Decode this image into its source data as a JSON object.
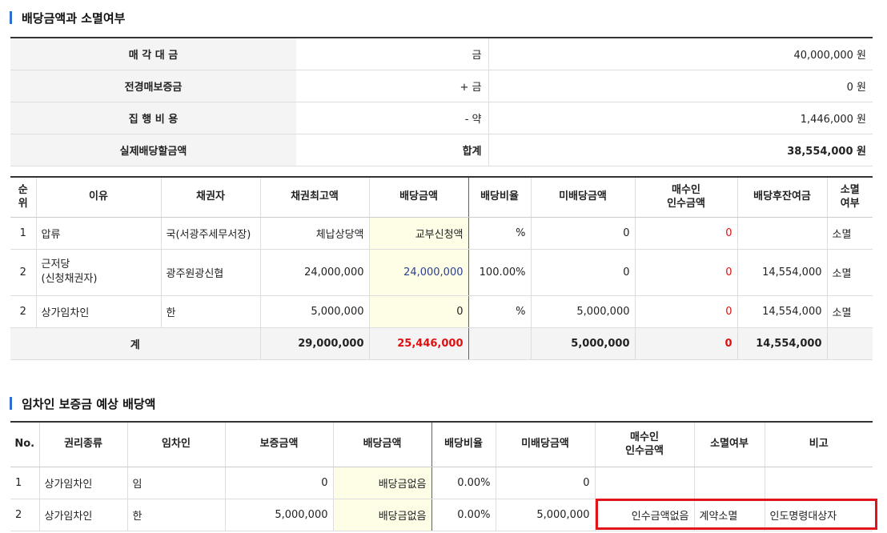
{
  "section1": {
    "title": "배당금액과 소멸여부"
  },
  "summary": [
    {
      "label": "매 각 대 금",
      "sign": "금",
      "amount": "40,000,000 원"
    },
    {
      "label": "전경매보증금",
      "sign": "+ 금",
      "amount": "0 원"
    },
    {
      "label": "집 행 비 용",
      "sign": "- 약",
      "amount": "1,446,000 원"
    },
    {
      "label": "실제배당할금액",
      "sign": "합계",
      "amount": "38,554,000 원"
    }
  ],
  "distribution": {
    "headers": [
      "순\n위",
      "이유",
      "채권자",
      "채권최고액",
      "배당금액",
      "배당비율",
      "미배당금액",
      "매수인\n인수금액",
      "배당후잔여금",
      "소멸\n여부"
    ],
    "rows": [
      {
        "rank": "1",
        "reason": "압류",
        "creditor": "국(서광주세무서장)",
        "max": "체납상당액",
        "paid": "교부신청액",
        "ratio": "%",
        "unpaid": "0",
        "buyer": "0",
        "remain": "",
        "status": "소멸"
      },
      {
        "rank": "2",
        "reason": "근저당\n(신청채권자)",
        "creditor": "광주원광신협",
        "max": "24,000,000",
        "paid": "24,000,000",
        "ratio": "100.00%",
        "unpaid": "0",
        "buyer": "0",
        "remain": "14,554,000",
        "status": "소멸"
      },
      {
        "rank": "2",
        "reason": "상가임차인",
        "creditor": "한",
        "max": "5,000,000",
        "paid": "0",
        "ratio": "%",
        "unpaid": "5,000,000",
        "buyer": "0",
        "remain": "14,554,000",
        "status": "소멸"
      }
    ],
    "total": {
      "label": "계",
      "max": "29,000,000",
      "paid": "25,446,000",
      "unpaid": "5,000,000",
      "buyer": "0",
      "remain": "14,554,000"
    }
  },
  "section2": {
    "title": "임차인 보증금 예상 배당액"
  },
  "tenant": {
    "headers": [
      "No.",
      "권리종류",
      "임차인",
      "보증금액",
      "배당금액",
      "배당비율",
      "미배당금액",
      "매수인\n인수금액",
      "소멸여부",
      "비고"
    ],
    "rows": [
      {
        "no": "1",
        "type": "상가임차인",
        "tenant": "임",
        "deposit": "0",
        "paid": "배당금없음",
        "ratio": "0.00%",
        "unpaid": "0",
        "buyer": "",
        "status": "",
        "note": ""
      },
      {
        "no": "2",
        "type": "상가임차인",
        "tenant": "한",
        "deposit": "5,000,000",
        "paid": "배당금없음",
        "ratio": "0.00%",
        "unpaid": "5,000,000",
        "buyer": "인수금액없음",
        "status": "계약소멸",
        "note": "인도명령대상자"
      }
    ]
  },
  "colors": {
    "accent": "#2f6fd0",
    "red": "#e01010",
    "highlight": "#fefde6",
    "blue_value": "#2b3f8f"
  }
}
